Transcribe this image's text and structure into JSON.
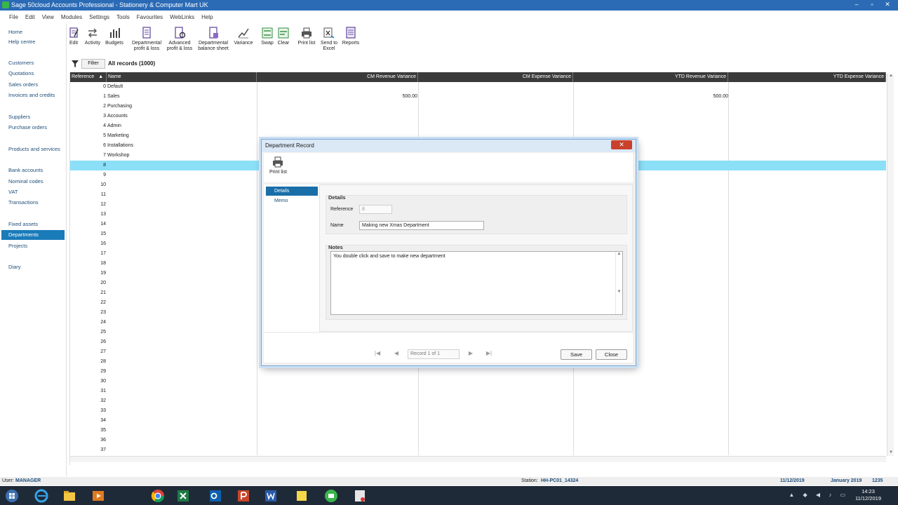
{
  "window": {
    "title": "Sage 50cloud Accounts Professional - Stationery & Computer Mart UK",
    "controls": [
      "–",
      "▫",
      "✕"
    ]
  },
  "menu": [
    "File",
    "Edit",
    "View",
    "Modules",
    "Settings",
    "Tools",
    "Favourites",
    "WebLinks",
    "Help"
  ],
  "nav": {
    "home": "Home",
    "help_centre": "Help centre",
    "customers": "Customers",
    "quotations": "Quotations",
    "sales_orders": "Sales orders",
    "invoices_credits": "Invoices and credits",
    "suppliers": "Suppliers",
    "purchase_orders": "Purchase orders",
    "products_services": "Products and services",
    "bank_accounts": "Bank accounts",
    "nominal_codes": "Nominal codes",
    "vat": "VAT",
    "transactions": "Transactions",
    "fixed_assets": "Fixed assets",
    "departments": "Departments",
    "projects": "Projects",
    "diary": "Diary"
  },
  "toolbar": {
    "edit": "Edit",
    "activity": "Activity",
    "budgets": "Budgets",
    "dept_pl_1": "Departmental",
    "dept_pl_2": "profit & loss",
    "adv_pl_1": "Advanced",
    "adv_pl_2": "profit & loss",
    "dept_bs_1": "Departmental",
    "dept_bs_2": "balance sheet",
    "variance": "Variance",
    "swap": "Swap",
    "clear": "Clear",
    "print_list": "Print list",
    "send_excel_1": "Send to",
    "send_excel_2": "Excel",
    "reports": "Reports"
  },
  "filter": {
    "button": "Filter",
    "records": "All records (1000)"
  },
  "grid": {
    "columns": {
      "reference": "Reference",
      "sort_indicator": "▲",
      "name": "Name",
      "cm_revenue": "CM Revenue Variance",
      "cm_expense": "CM Expense Variance",
      "ytd_revenue": "YTD Revenue Variance",
      "ytd_expense": "YTD Expense Variance"
    },
    "rows": [
      {
        "ref": "0",
        "name": "Default",
        "cm_rev": "",
        "ytd_rev": ""
      },
      {
        "ref": "1",
        "name": "Sales",
        "cm_rev": "500.00",
        "ytd_rev": "500.00"
      },
      {
        "ref": "2",
        "name": "Purchasing",
        "cm_rev": "",
        "ytd_rev": ""
      },
      {
        "ref": "3",
        "name": "Accounts",
        "cm_rev": "",
        "ytd_rev": ""
      },
      {
        "ref": "4",
        "name": "Admin",
        "cm_rev": "",
        "ytd_rev": ""
      },
      {
        "ref": "5",
        "name": "Marketing",
        "cm_rev": "",
        "ytd_rev": ""
      },
      {
        "ref": "6",
        "name": "Installations",
        "cm_rev": "",
        "ytd_rev": ""
      },
      {
        "ref": "7",
        "name": "Workshop",
        "cm_rev": "",
        "ytd_rev": ""
      },
      {
        "ref": "8",
        "name": "",
        "cm_rev": "",
        "ytd_rev": ""
      },
      {
        "ref": "9",
        "name": "",
        "cm_rev": "",
        "ytd_rev": ""
      },
      {
        "ref": "10",
        "name": "",
        "cm_rev": "",
        "ytd_rev": ""
      },
      {
        "ref": "11",
        "name": "",
        "cm_rev": "",
        "ytd_rev": ""
      },
      {
        "ref": "12",
        "name": "",
        "cm_rev": "",
        "ytd_rev": ""
      },
      {
        "ref": "13",
        "name": "",
        "cm_rev": "",
        "ytd_rev": ""
      },
      {
        "ref": "14",
        "name": "",
        "cm_rev": "",
        "ytd_rev": ""
      },
      {
        "ref": "15",
        "name": "",
        "cm_rev": "",
        "ytd_rev": ""
      },
      {
        "ref": "16",
        "name": "",
        "cm_rev": "",
        "ytd_rev": ""
      },
      {
        "ref": "17",
        "name": "",
        "cm_rev": "",
        "ytd_rev": ""
      },
      {
        "ref": "18",
        "name": "",
        "cm_rev": "",
        "ytd_rev": ""
      },
      {
        "ref": "19",
        "name": "",
        "cm_rev": "",
        "ytd_rev": ""
      },
      {
        "ref": "20",
        "name": "",
        "cm_rev": "",
        "ytd_rev": ""
      },
      {
        "ref": "21",
        "name": "",
        "cm_rev": "",
        "ytd_rev": ""
      },
      {
        "ref": "22",
        "name": "",
        "cm_rev": "",
        "ytd_rev": ""
      },
      {
        "ref": "23",
        "name": "",
        "cm_rev": "",
        "ytd_rev": ""
      },
      {
        "ref": "24",
        "name": "",
        "cm_rev": "",
        "ytd_rev": ""
      },
      {
        "ref": "25",
        "name": "",
        "cm_rev": "",
        "ytd_rev": ""
      },
      {
        "ref": "26",
        "name": "",
        "cm_rev": "",
        "ytd_rev": ""
      },
      {
        "ref": "27",
        "name": "",
        "cm_rev": "",
        "ytd_rev": ""
      },
      {
        "ref": "28",
        "name": "",
        "cm_rev": "",
        "ytd_rev": ""
      },
      {
        "ref": "29",
        "name": "",
        "cm_rev": "",
        "ytd_rev": ""
      },
      {
        "ref": "30",
        "name": "",
        "cm_rev": "",
        "ytd_rev": ""
      },
      {
        "ref": "31",
        "name": "",
        "cm_rev": "",
        "ytd_rev": ""
      },
      {
        "ref": "32",
        "name": "",
        "cm_rev": "",
        "ytd_rev": ""
      },
      {
        "ref": "33",
        "name": "",
        "cm_rev": "",
        "ytd_rev": ""
      },
      {
        "ref": "34",
        "name": "",
        "cm_rev": "",
        "ytd_rev": ""
      },
      {
        "ref": "35",
        "name": "",
        "cm_rev": "",
        "ytd_rev": ""
      },
      {
        "ref": "36",
        "name": "",
        "cm_rev": "",
        "ytd_rev": ""
      },
      {
        "ref": "37",
        "name": "",
        "cm_rev": "",
        "ytd_rev": ""
      }
    ],
    "selected_ref": "8"
  },
  "dialog": {
    "title": "Department Record",
    "close_glyph": "✕",
    "print_list": "Print list",
    "tabs": [
      "Details",
      "Memo"
    ],
    "details_heading": "Details",
    "reference_label": "Reference",
    "reference_value": "8",
    "name_label": "Name",
    "name_value": "Making new Xmas Department",
    "notes_heading": "Notes",
    "notes_value": "You double click and save to make new department",
    "record_text": "Record 1 of 1",
    "save": "Save",
    "close": "Close"
  },
  "status": {
    "user_label": "User:",
    "user": "MANAGER",
    "station_label": "Station:",
    "station": "HH-PC01_14324",
    "date": "11/12/2019",
    "period": "January 2019",
    "number": "1235"
  },
  "taskbar": {
    "time": "14:23",
    "date": "11/12/2019"
  },
  "colors": {
    "title_bar": "#2b6bb6",
    "nav_active": "#1a7bb9",
    "grid_header": "#3a3a3a",
    "selected_row": "#8be0f7",
    "dialog_close": "#c9412c"
  }
}
